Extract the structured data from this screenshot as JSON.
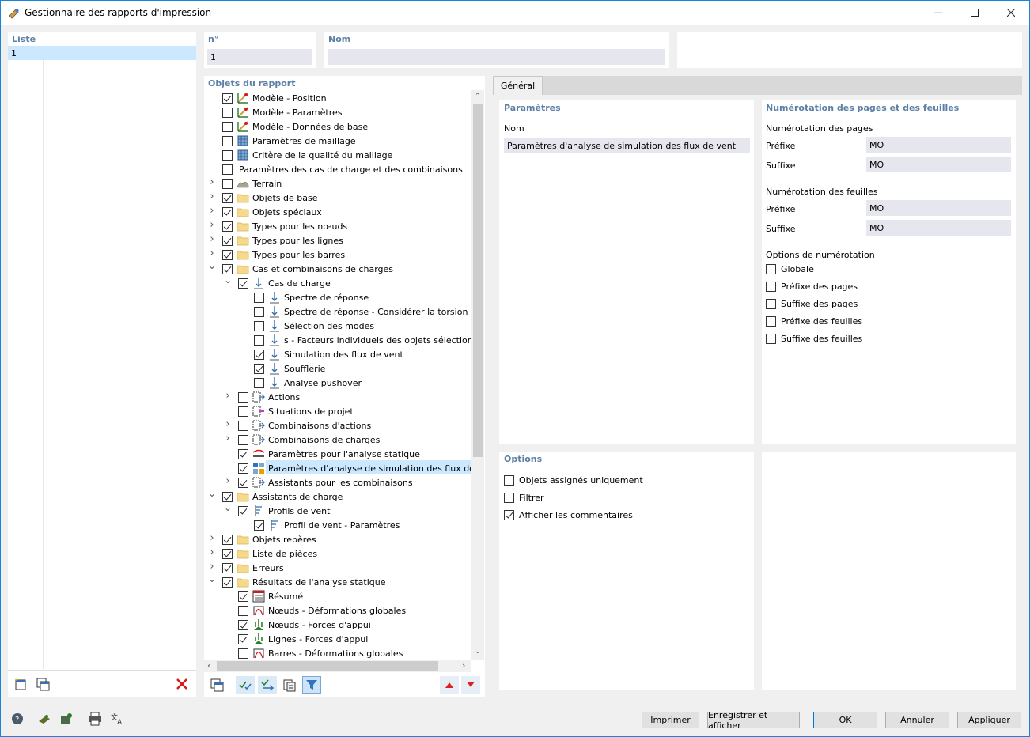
{
  "window": {
    "title": "Gestionnaire des rapports d'impression"
  },
  "list": {
    "header": "Liste",
    "items": [
      "1"
    ]
  },
  "number": {
    "label": "n°",
    "value": "1"
  },
  "name": {
    "label": "Nom",
    "value": ""
  },
  "tree": {
    "header": "Objets du rapport",
    "rows": [
      {
        "label": "Modèle - Position",
        "level": 0,
        "checked": true,
        "expander": "",
        "icon": "model-icon"
      },
      {
        "label": "Modèle - Paramètres",
        "level": 0,
        "checked": false,
        "expander": "",
        "icon": "model-icon"
      },
      {
        "label": "Modèle - Données de base",
        "level": 0,
        "checked": false,
        "expander": "",
        "icon": "model-icon"
      },
      {
        "label": "Paramètres de maillage",
        "level": 0,
        "checked": false,
        "expander": "",
        "icon": "mesh-icon"
      },
      {
        "label": "Critère de la qualité du maillage",
        "level": 0,
        "checked": false,
        "expander": "",
        "icon": "mesh-icon"
      },
      {
        "label": "Paramètres des cas de charge et des combinaisons",
        "level": 0,
        "checked": false,
        "expander": "",
        "icon": "none"
      },
      {
        "label": "Terrain",
        "level": 0,
        "checked": false,
        "expander": "collapsed",
        "icon": "terrain-icon"
      },
      {
        "label": "Objets de base",
        "level": 0,
        "checked": true,
        "expander": "collapsed",
        "icon": "folder-icon"
      },
      {
        "label": "Objets spéciaux",
        "level": 0,
        "checked": true,
        "expander": "collapsed",
        "icon": "folder-icon"
      },
      {
        "label": "Types pour les nœuds",
        "level": 0,
        "checked": true,
        "expander": "collapsed",
        "icon": "folder-icon"
      },
      {
        "label": "Types pour les lignes",
        "level": 0,
        "checked": true,
        "expander": "collapsed",
        "icon": "folder-icon"
      },
      {
        "label": "Types pour les barres",
        "level": 0,
        "checked": true,
        "expander": "collapsed",
        "icon": "folder-icon"
      },
      {
        "label": "Cas et combinaisons de charges",
        "level": 0,
        "checked": true,
        "expander": "expanded",
        "icon": "folder-icon"
      },
      {
        "label": "Cas de charge",
        "level": 1,
        "checked": true,
        "expander": "expanded",
        "icon": "load-icon"
      },
      {
        "label": "Spectre de réponse",
        "level": 2,
        "checked": false,
        "expander": "",
        "icon": "load-icon"
      },
      {
        "label": "Spectre de réponse - Considérer la torsion acc",
        "level": 2,
        "checked": false,
        "expander": "",
        "icon": "load-icon"
      },
      {
        "label": "Sélection des modes",
        "level": 2,
        "checked": false,
        "expander": "",
        "icon": "load-icon"
      },
      {
        "label": "s - Facteurs individuels des objets sélectionné",
        "level": 2,
        "checked": false,
        "expander": "",
        "icon": "load-icon"
      },
      {
        "label": "Simulation des flux de vent",
        "level": 2,
        "checked": true,
        "expander": "",
        "icon": "load-icon"
      },
      {
        "label": "Soufflerie",
        "level": 2,
        "checked": true,
        "expander": "",
        "icon": "load-icon"
      },
      {
        "label": "Analyse pushover",
        "level": 2,
        "checked": false,
        "expander": "",
        "icon": "load-icon"
      },
      {
        "label": "Actions",
        "level": 1,
        "checked": false,
        "expander": "collapsed",
        "icon": "action-icon"
      },
      {
        "label": "Situations de projet",
        "level": 1,
        "checked": false,
        "expander": "",
        "icon": "situation-icon"
      },
      {
        "label": "Combinaisons d'actions",
        "level": 1,
        "checked": false,
        "expander": "collapsed",
        "icon": "action-icon"
      },
      {
        "label": "Combinaisons de charges",
        "level": 1,
        "checked": false,
        "expander": "collapsed",
        "icon": "action-icon"
      },
      {
        "label": "Paramètres pour l'analyse statique",
        "level": 1,
        "checked": true,
        "expander": "",
        "icon": "static-icon"
      },
      {
        "label": "Paramètres d'analyse de simulation des flux de ven",
        "level": 1,
        "checked": true,
        "expander": "",
        "icon": "wind-icon",
        "selected": true
      },
      {
        "label": "Assistants pour les combinaisons",
        "level": 1,
        "checked": true,
        "expander": "collapsed",
        "icon": "action-icon"
      },
      {
        "label": "Assistants de charge",
        "level": 0,
        "checked": true,
        "expander": "expanded",
        "icon": "folder-icon"
      },
      {
        "label": "Profils de vent",
        "level": 1,
        "checked": true,
        "expander": "expanded",
        "icon": "profile-icon"
      },
      {
        "label": "Profil de vent - Paramètres",
        "level": 2,
        "checked": true,
        "expander": "",
        "icon": "profile-icon"
      },
      {
        "label": "Objets repères",
        "level": 0,
        "checked": true,
        "expander": "collapsed",
        "icon": "folder-icon"
      },
      {
        "label": "Liste de pièces",
        "level": 0,
        "checked": true,
        "expander": "collapsed",
        "icon": "folder-icon"
      },
      {
        "label": "Erreurs",
        "level": 0,
        "checked": true,
        "expander": "collapsed",
        "icon": "folder-icon"
      },
      {
        "label": "Résultats de l'analyse statique",
        "level": 0,
        "checked": true,
        "expander": "expanded",
        "icon": "folder-icon"
      },
      {
        "label": "Résumé",
        "level": 1,
        "checked": true,
        "expander": "",
        "icon": "summary-icon"
      },
      {
        "label": "Nœuds - Déformations globales",
        "level": 1,
        "checked": false,
        "expander": "",
        "icon": "deform-icon"
      },
      {
        "label": "Nœuds - Forces d'appui",
        "level": 1,
        "checked": true,
        "expander": "",
        "icon": "support-icon"
      },
      {
        "label": "Lignes - Forces d'appui",
        "level": 1,
        "checked": true,
        "expander": "",
        "icon": "support-icon"
      },
      {
        "label": "Barres - Déformations globales",
        "level": 1,
        "checked": false,
        "expander": "",
        "icon": "deform-icon"
      }
    ]
  },
  "tabs": {
    "general": "Général"
  },
  "params": {
    "header": "Paramètres",
    "name_label": "Nom",
    "name_value": "Paramètres d'analyse de simulation des flux de vent"
  },
  "numbering": {
    "header": "Numérotation des pages et des feuilles",
    "pages_header": "Numérotation des pages",
    "sheets_header": "Numérotation des feuilles",
    "prefix_label": "Préfixe",
    "suffix_label": "Suffixe",
    "page_prefix": "MO",
    "page_suffix": "MO",
    "sheet_prefix": "MO",
    "sheet_suffix": "MO",
    "options_header": "Options de numérotation",
    "options": [
      {
        "label": "Globale",
        "checked": false
      },
      {
        "label": "Préfixe des pages",
        "checked": false
      },
      {
        "label": "Suffixe des pages",
        "checked": false
      },
      {
        "label": "Préfixe des feuilles",
        "checked": false
      },
      {
        "label": "Suffixe des feuilles",
        "checked": false
      }
    ]
  },
  "options": {
    "header": "Options",
    "items": [
      {
        "label": "Objets assignés uniquement",
        "checked": false
      },
      {
        "label": "Filtrer",
        "checked": false
      },
      {
        "label": "Afficher les commentaires",
        "checked": true
      }
    ]
  },
  "buttons": {
    "print": "Imprimer",
    "save_show": "Enregistrer et afficher",
    "ok": "OK",
    "cancel": "Annuler",
    "apply": "Appliquer"
  },
  "colors": {
    "accent": "#1883d7",
    "header_text": "#5b7fa6",
    "selection": "#cce8ff",
    "field": "#e6e6ee"
  }
}
